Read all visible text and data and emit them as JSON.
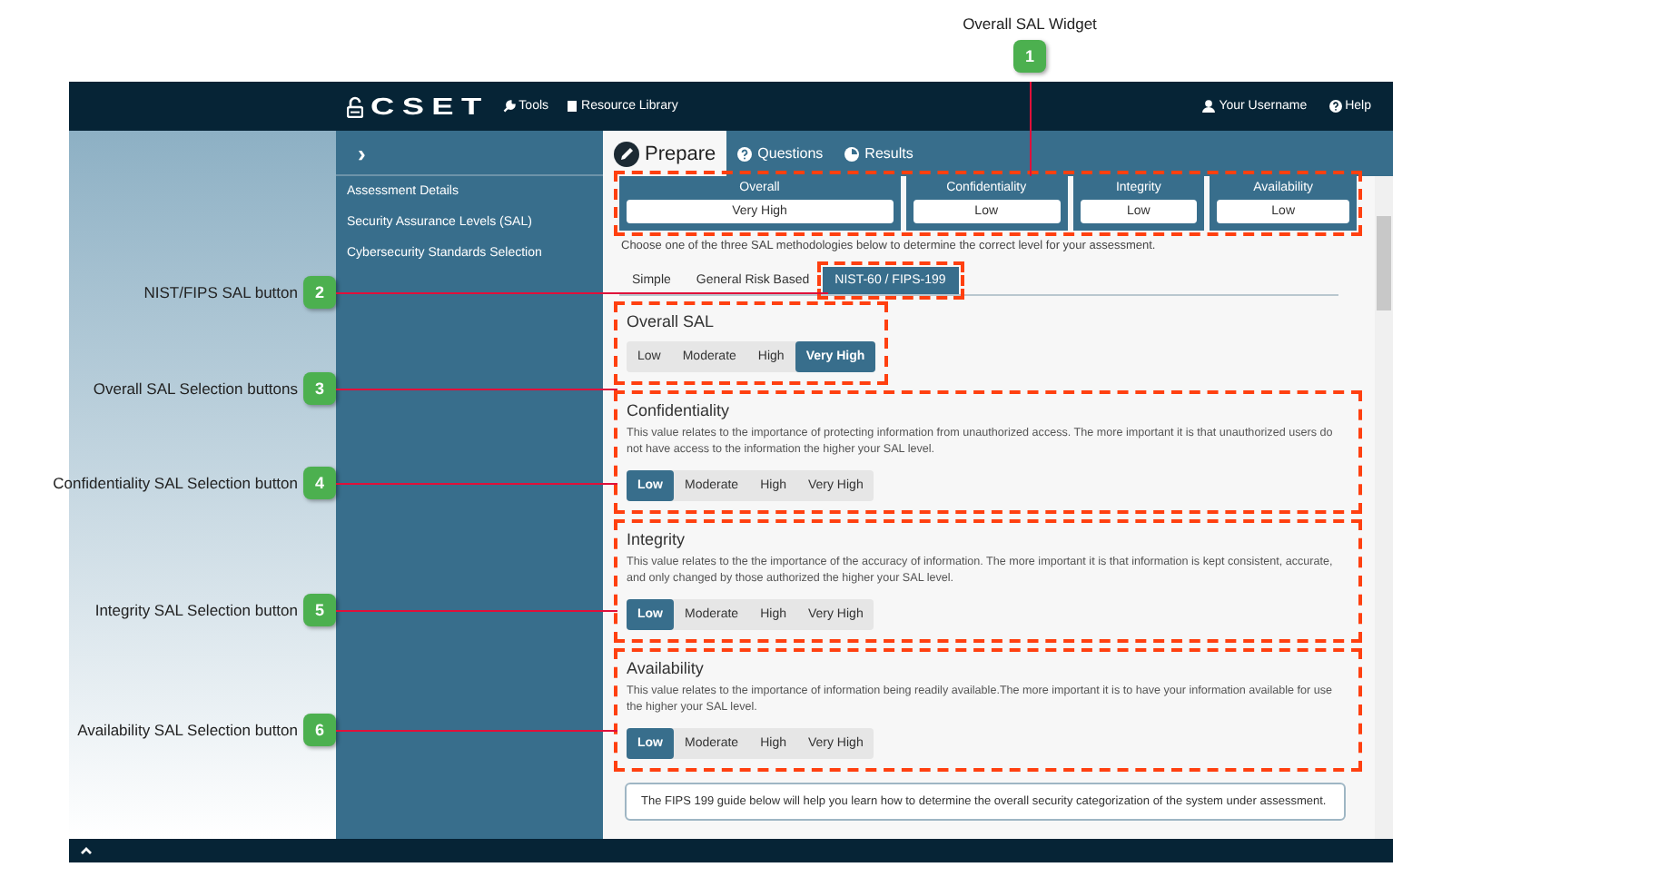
{
  "annotations": [
    {
      "number": "1",
      "label": "Overall SAL Widget"
    },
    {
      "number": "2",
      "label": "NIST/FIPS SAL button"
    },
    {
      "number": "3",
      "label": "Overall SAL Selection buttons"
    },
    {
      "number": "4",
      "label": "Confidentiality SAL Selection button"
    },
    {
      "number": "5",
      "label": "Integrity SAL Selection button"
    },
    {
      "number": "6",
      "label": "Availability SAL Selection button"
    }
  ],
  "topbar": {
    "logo": "CSET",
    "nav": [
      {
        "kind": "tools",
        "label": "Tools"
      },
      {
        "kind": "library",
        "label": "Resource Library"
      }
    ],
    "user": "Your Username",
    "help": "Help"
  },
  "sidebar": {
    "toggle": "›",
    "items": [
      "Assessment Details",
      "Security Assurance Levels (SAL)",
      "Cybersecurity Standards Selection"
    ]
  },
  "tabs": [
    {
      "kind": "prepare",
      "label": "Prepare",
      "selected": true
    },
    {
      "kind": "questions",
      "label": "Questions",
      "selected": false
    },
    {
      "kind": "results",
      "label": "Results",
      "selected": false
    }
  ],
  "sal_widget": {
    "highlighted": true,
    "items": [
      {
        "label": "Overall",
        "value": "Very High"
      },
      {
        "label": "Confidentiality",
        "value": "Low"
      },
      {
        "label": "Integrity",
        "value": "Low"
      },
      {
        "label": "Availability",
        "value": "Low"
      }
    ]
  },
  "instruction": "Choose one of the three SAL methodologies below to determine the correct level for your assessment.",
  "methods": [
    {
      "label": "Simple",
      "selected": false,
      "highlighted": false
    },
    {
      "label": "General Risk Based",
      "selected": false,
      "highlighted": false
    },
    {
      "label": "NIST-60 / FIPS-199",
      "selected": true,
      "highlighted": true
    }
  ],
  "sections": [
    {
      "title": "Overall SAL",
      "highlighted": true,
      "options": [
        {
          "label": "Low",
          "selected": false
        },
        {
          "label": "Moderate",
          "selected": false
        },
        {
          "label": "High",
          "selected": false
        },
        {
          "label": "Very High",
          "selected": true
        }
      ]
    },
    {
      "title": "Confidentiality",
      "highlighted": true,
      "description": "This value relates to the importance of protecting information from unauthorized access. The more important it is that unauthorized users do not have access to the information the higher your SAL level.",
      "options": [
        {
          "label": "Low",
          "selected": true
        },
        {
          "label": "Moderate",
          "selected": false
        },
        {
          "label": "High",
          "selected": false
        },
        {
          "label": "Very High",
          "selected": false
        }
      ]
    },
    {
      "title": "Integrity",
      "highlighted": true,
      "description": "This value relates to the the importance of the accuracy of information. The more important it is that information is kept consistent, accurate, and only changed by those authorized the higher your SAL level.",
      "options": [
        {
          "label": "Low",
          "selected": true
        },
        {
          "label": "Moderate",
          "selected": false
        },
        {
          "label": "High",
          "selected": false
        },
        {
          "label": "Very High",
          "selected": false
        }
      ]
    },
    {
      "title": "Availability",
      "highlighted": true,
      "description": "This value relates to the importance of information being readily available.The more important it is to have your information available for use the higher your SAL level.",
      "options": [
        {
          "label": "Low",
          "selected": true
        },
        {
          "label": "Moderate",
          "selected": false
        },
        {
          "label": "High",
          "selected": false
        },
        {
          "label": "Very High",
          "selected": false
        }
      ]
    }
  ],
  "guide": "The FIPS 199 guide below will help you learn how to determine the overall security categorization of the system under assessment."
}
